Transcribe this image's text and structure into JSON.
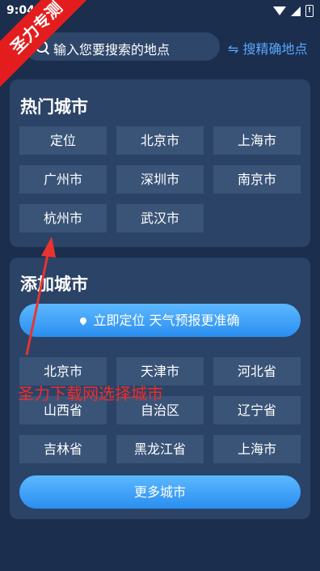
{
  "status_bar": {
    "time": "9:04",
    "battery_glyph": "!"
  },
  "search": {
    "placeholder": "输入您要搜索的地点",
    "precise_link": "⇋ 搜精确地点"
  },
  "hot_cities": {
    "title": "热门城市",
    "items": [
      "定位",
      "北京市",
      "上海市",
      "广州市",
      "深圳市",
      "南京市",
      "杭州市",
      "武汉市"
    ]
  },
  "add_city": {
    "title": "添加城市",
    "locate_button": "立即定位 天气预报更准确",
    "items": [
      "北京市",
      "天津市",
      "河北省",
      "山西省",
      "自治区",
      "辽宁省",
      "吉林省",
      "黑龙江省",
      "上海市"
    ],
    "more_button": "更多城市"
  },
  "overlay": {
    "corner_badge": "圣力专测",
    "caption": "圣力下载网选择城市",
    "color": "#e31d1d"
  },
  "colors": {
    "background": "#1b2e4e",
    "card": "#2a4366",
    "button": "#3a5478",
    "accent": "#2a8ef0"
  }
}
